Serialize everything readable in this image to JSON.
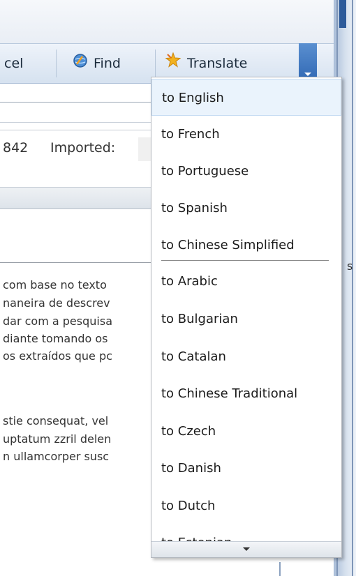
{
  "toolbar": {
    "cancel_label": "cel",
    "find_label": "Find",
    "translate_label": "Translate"
  },
  "record": {
    "id_fragment": "842",
    "imported_label": "Imported:"
  },
  "body_lines_1": [
    "com base no texto",
    "naneira de descrev",
    "dar com a pesquisa",
    "diante tomando os",
    "os extraídos que pc"
  ],
  "body_lines_2": [
    "stie consequat, vel",
    "uptatum zzril delen",
    "n ullamcorper susc"
  ],
  "right_edge_text": "s",
  "translate_menu": {
    "items": [
      "to English",
      "to French",
      "to Portuguese",
      "to Spanish",
      "to Chinese Simplified",
      "to Arabic",
      "to Bulgarian",
      "to Catalan",
      "to Chinese Traditional",
      "to Czech",
      "to Danish",
      "to Dutch",
      "to Estonian"
    ],
    "highlighted_index": 0
  },
  "icons": {
    "find": "find-globe-icon",
    "translate": "translate-star-icon"
  },
  "colors": {
    "toolbar_accent": "#2f67b3",
    "menu_hover": "#eaf3fc"
  }
}
